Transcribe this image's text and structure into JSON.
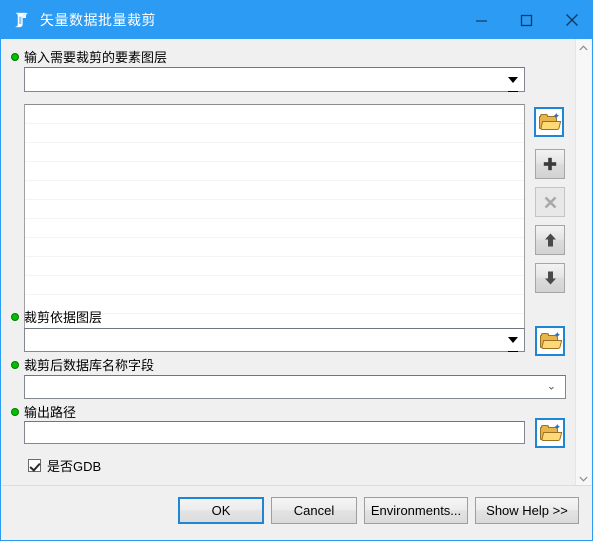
{
  "window": {
    "title": "矢量数据批量裁剪",
    "icon": "script-tool-icon",
    "controls": {
      "minimize": "─",
      "maximize": "☐",
      "close": "✕"
    }
  },
  "theme": {
    "titlebar_bg": "#2b9bf4",
    "titlebar_fg": "#ffffff",
    "dialog_bg": "#f0f0f0",
    "required_dot": "#00c000",
    "focus_border": "#1f86d6"
  },
  "parameters": [
    {
      "label": "输入需要裁剪的要素图层",
      "required": true,
      "control": "combobox",
      "value": "",
      "placeholder": ""
    },
    {
      "label": "裁剪依据图层",
      "required": true,
      "control": "combobox",
      "value": "",
      "placeholder": ""
    },
    {
      "label": "裁剪后数据库名称字段",
      "required": true,
      "control": "combobox-field",
      "value": "",
      "placeholder": ""
    },
    {
      "label": "输出路径",
      "required": true,
      "control": "textbox",
      "value": "",
      "placeholder": ""
    }
  ],
  "multivalue_list": {
    "items": [],
    "visible_rows": 10
  },
  "side_tools": [
    {
      "name": "browse-input-layer",
      "icon": "open-folder-icon",
      "glyph": "",
      "state": "focused"
    },
    {
      "name": "add-row",
      "icon": "plus-icon",
      "glyph": "➕",
      "state": "enabled"
    },
    {
      "name": "remove-row",
      "icon": "close-x-icon",
      "glyph": "✕",
      "state": "disabled"
    },
    {
      "name": "move-up",
      "icon": "arrow-up-icon",
      "glyph": "⬆",
      "state": "enabled"
    },
    {
      "name": "move-down",
      "icon": "arrow-down-icon",
      "glyph": "⬇",
      "state": "enabled"
    }
  ],
  "browse_buttons": {
    "clip_layer": "open-folder-icon",
    "output_path": "open-folder-icon"
  },
  "checkbox": {
    "label": "是否GDB",
    "checked": true
  },
  "buttons": {
    "ok": "OK",
    "cancel": "Cancel",
    "environments": "Environments...",
    "show_help": "Show Help >>"
  },
  "scrollbar": {
    "up_glyph": "∧",
    "down_glyph": "∨"
  }
}
